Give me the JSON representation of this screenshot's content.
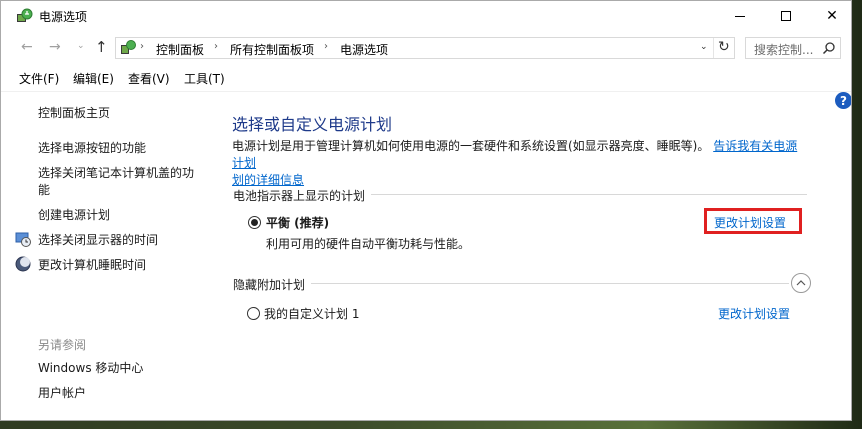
{
  "window": {
    "title": "电源选项",
    "min_icon": "minimize-icon",
    "max_icon": "maximize-icon",
    "close_glyph": "✕"
  },
  "nav": {
    "back_glyph": "←",
    "forward_glyph": "→",
    "history_glyph": "⌄",
    "up_glyph": "↑",
    "breadcrumb": [
      "控制面板",
      "所有控制面板项",
      "电源选项"
    ],
    "sep_glyph": "›",
    "dropdown_glyph": "⌄",
    "refresh_glyph": "↻",
    "search_placeholder": "搜索控制..."
  },
  "menu": [
    "文件(F)",
    "编辑(E)",
    "查看(V)",
    "工具(T)"
  ],
  "sidebar": {
    "home": "控制面板主页",
    "links": [
      "选择电源按钮的功能",
      "选择关闭笔记本计算机盖的功",
      "能",
      "创建电源计划",
      "选择关闭显示器的时间",
      "更改计算机睡眠时间"
    ],
    "see_also": "另请参阅",
    "see_also_links": [
      "Windows 移动中心",
      "用户帐户"
    ]
  },
  "main": {
    "title": "选择或自定义电源计划",
    "description": "电源计划是用于管理计算机如何使用电源的一套硬件和系统设置(如显示器亮度、睡眠等)。",
    "description_link_1": "告诉我有关电源计划",
    "description_link_2": "划的详细信息",
    "battery_section": "电池指示器上显示的计划",
    "plan_balanced": "平衡 (推荐)",
    "plan_balanced_desc": "利用可用的硬件自动平衡功耗与性能。",
    "change_plan_settings": "更改计划设置",
    "hidden_section": "隐藏附加计划",
    "plan_custom": "我的自定义计划 1",
    "change_plan_settings_2": "更改计划设置",
    "help_glyph": "?"
  },
  "colors": {
    "accent_link": "#0066cc",
    "title_blue": "#1e3a8a",
    "highlight": "#e02020"
  }
}
